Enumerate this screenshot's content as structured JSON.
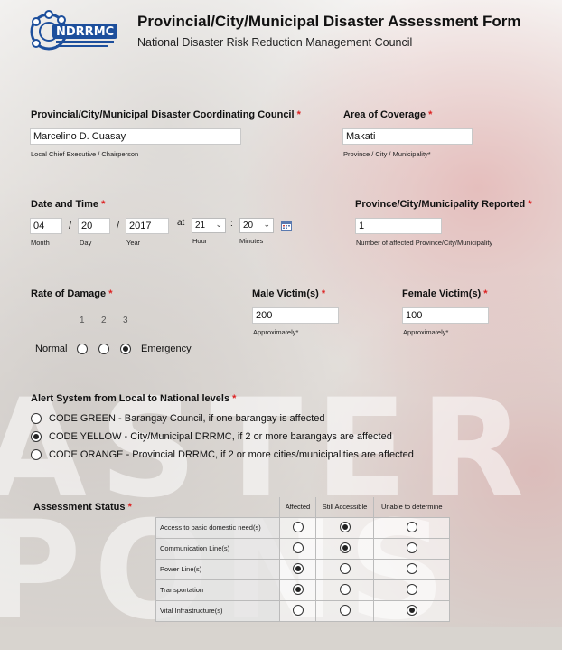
{
  "header": {
    "logo_text": "NDRRMC",
    "title": "Provincial/City/Municipal Disaster Assessment Form",
    "subtitle": "National Disaster Risk Reduction Management Council"
  },
  "required_mark": "*",
  "council": {
    "label": "Provincial/City/Municipal Disaster Coordinating Council",
    "value": "Marcelino D. Cuasay",
    "help": "Local Chief Executive / Chairperson"
  },
  "coverage": {
    "label": "Area of Coverage",
    "value": "Makati",
    "help": "Province / City / Municipality*"
  },
  "datetime": {
    "label": "Date and Time",
    "month": "04",
    "day": "20",
    "year": "2017",
    "sep": "/",
    "at": "at",
    "colon": ":",
    "hour": "21",
    "minutes": "20",
    "month_label": "Month",
    "day_label": "Day",
    "year_label": "Year",
    "hour_label": "Hour",
    "minutes_label": "Minutes"
  },
  "reported": {
    "label": "Province/City/Municipality Reported",
    "value": "1",
    "help": "Number of affected Province/City/Municipality"
  },
  "damage": {
    "label": "Rate of Damage",
    "scale": [
      "1",
      "2",
      "3"
    ],
    "low_label": "Normal",
    "high_label": "Emergency",
    "selected": 3
  },
  "male": {
    "label": "Male Victim(s)",
    "value": "200",
    "help": "Approximately*"
  },
  "female": {
    "label": "Female Victim(s)",
    "value": "100",
    "help": "Approximately*"
  },
  "alert": {
    "label": "Alert System from Local to National levels",
    "options": [
      {
        "text": "CODE GREEN - Barangay Council, if one barangay is affected",
        "selected": false
      },
      {
        "text": "CODE YELLOW - City/Municipal DRRMC, if 2 or more barangays are affected",
        "selected": true
      },
      {
        "text": "CODE ORANGE - Provincial DRRMC, if 2 or more cities/municipalities are affected",
        "selected": false
      }
    ]
  },
  "assessment": {
    "label": "Assessment Status",
    "columns": [
      "Affected",
      "Still Accessible",
      "Unable to determine"
    ],
    "rows": [
      {
        "label": "Access to basic domestic need(s)",
        "selected": 1
      },
      {
        "label": "Communication Line(s)",
        "selected": 1
      },
      {
        "label": "Power Line(s)",
        "selected": 0
      },
      {
        "label": "Transportation",
        "selected": 0
      },
      {
        "label": "Vital Infrastructure(s)",
        "selected": 2
      }
    ]
  }
}
